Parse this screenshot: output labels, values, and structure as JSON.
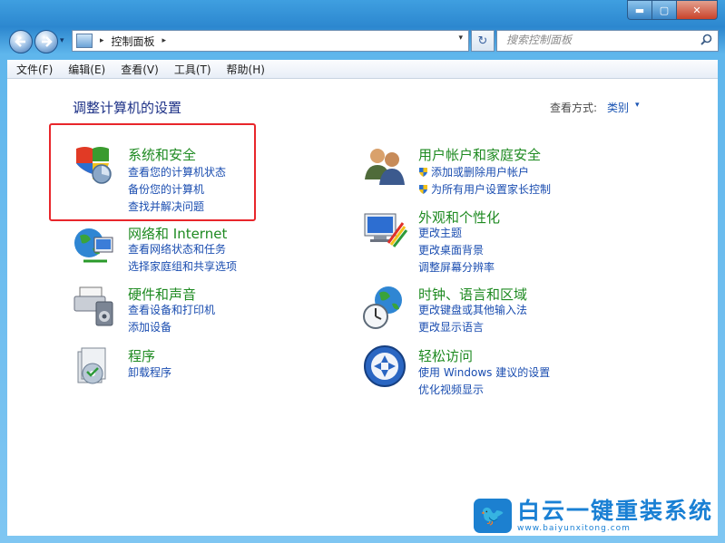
{
  "window": {
    "minimize": "▬",
    "maximize": "▢",
    "close": "✕"
  },
  "nav": {
    "back_icon": "arrow-left-icon",
    "forward_icon": "arrow-right-icon",
    "history": "▾",
    "address": {
      "crumb": "控制面板",
      "separator": "▸",
      "dropdown": "▾"
    },
    "refresh": "↻",
    "search_placeholder": "搜索控制面板",
    "search_icon": "⚲"
  },
  "menu": [
    "文件(F)",
    "编辑(E)",
    "查看(V)",
    "工具(T)",
    "帮助(H)"
  ],
  "content": {
    "title": "调整计算机的设置",
    "view_by_label": "查看方式:",
    "view_by_value": "类别",
    "view_by_arrow": "▾",
    "left_categories": [
      {
        "title": "系统和安全",
        "icon": "shield-icon",
        "links": [
          "查看您的计算机状态",
          "备份您的计算机",
          "查找并解决问题"
        ]
      },
      {
        "title": "网络和 Internet",
        "icon": "globe-network-icon",
        "links": [
          "查看网络状态和任务",
          "选择家庭组和共享选项"
        ]
      },
      {
        "title": "硬件和声音",
        "icon": "printer-speaker-icon",
        "links": [
          "查看设备和打印机",
          "添加设备"
        ]
      },
      {
        "title": "程序",
        "icon": "program-disc-icon",
        "links": [
          "卸载程序"
        ]
      }
    ],
    "right_categories": [
      {
        "title": "用户帐户和家庭安全",
        "icon": "users-icon",
        "links": [
          "添加或删除用户帐户",
          "为所有用户设置家长控制"
        ]
      },
      {
        "title": "外观和个性化",
        "icon": "monitor-palette-icon",
        "links": [
          "更改主题",
          "更改桌面背景",
          "调整屏幕分辨率"
        ]
      },
      {
        "title": "时钟、语言和区域",
        "icon": "clock-globe-icon",
        "links": [
          "更改键盘或其他输入法",
          "更改显示语言"
        ]
      },
      {
        "title": "轻松访问",
        "icon": "accessibility-icon",
        "links": [
          "使用 Windows 建议的设置",
          "优化视频显示"
        ]
      }
    ]
  },
  "watermark": {
    "brand": "白云一键重装系统",
    "url": "www.baiyunxitong.com",
    "bird": "🐦"
  },
  "colors": {
    "category_title": "#1e8a21",
    "link": "#1a4db0",
    "highlight": "#e8262b",
    "frame": "#2c87cf"
  }
}
